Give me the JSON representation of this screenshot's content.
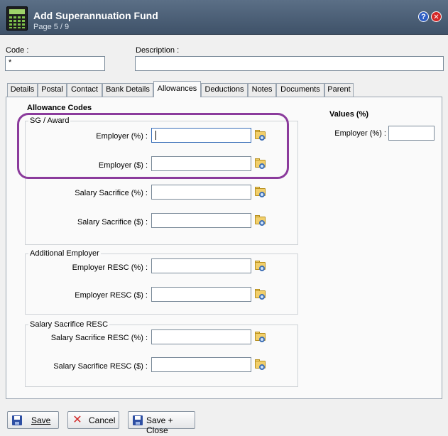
{
  "window": {
    "title": "Add Superannuation Fund",
    "page_indicator": "Page 5 / 9",
    "help_label": "?",
    "close_label": "✕"
  },
  "header": {
    "code_label": "Code :",
    "code_value": "*",
    "description_label": "Description :",
    "description_value": ""
  },
  "tabs": [
    {
      "label": "Details"
    },
    {
      "label": "Postal"
    },
    {
      "label": "Contact"
    },
    {
      "label": "Bank Details"
    },
    {
      "label": "Allowances"
    },
    {
      "label": "Deductions"
    },
    {
      "label": "Notes"
    },
    {
      "label": "Documents"
    },
    {
      "label": "Parent"
    }
  ],
  "active_tab": "Allowances",
  "allowance_codes": {
    "title": "Allowance Codes",
    "sg_award": {
      "legend": "SG / Award",
      "employer_pct_label": "Employer (%) :",
      "employer_amt_label": "Employer ($) :",
      "salary_sacrifice_pct_label": "Salary Sacrifice (%) :",
      "salary_sacrifice_amt_label": "Salary Sacrifice ($) :"
    },
    "additional_employer": {
      "legend": "Additional Employer",
      "resc_pct_label": "Employer RESC (%) :",
      "resc_amt_label": "Employer RESC ($) :"
    },
    "salary_sacrifice_resc": {
      "legend": "Salary Sacrifice RESC",
      "resc_pct_label": "Salary Sacrifice RESC (%) :",
      "resc_amt_label": "Salary Sacrifice RESC ($) :"
    }
  },
  "values": {
    "title": "Values (%)",
    "employer_pct_label": "Employer (%) :"
  },
  "footer": {
    "save_prefix": "",
    "save_label": "Save",
    "cancel_label": "Cancel",
    "save_close_label": "Save + Close"
  },
  "colors": {
    "title_bar": "#4a5d75",
    "highlight": "#8b3b9c"
  }
}
